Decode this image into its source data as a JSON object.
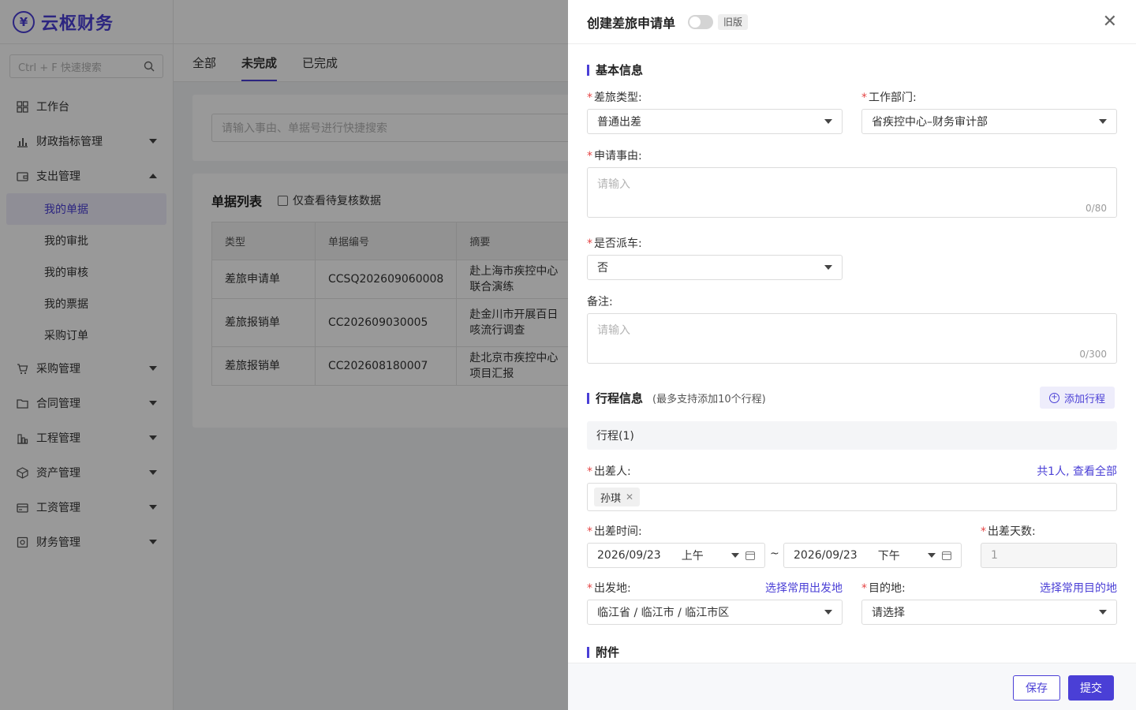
{
  "app": {
    "logo_glyph": "¥",
    "title": "云枢财务",
    "brand_color": "#4a3fd6"
  },
  "sidebar": {
    "search_placeholder": "Ctrl + F 快速搜索",
    "menu": {
      "workbench": "工作台",
      "finance_index": "财政指标管理",
      "expense": "支出管理",
      "expense_sub": [
        "我的单据",
        "我的审批",
        "我的审核",
        "我的票据",
        "采购订单"
      ],
      "purchase": "采购管理",
      "contract": "合同管理",
      "engineering": "工程管理",
      "asset": "资产管理",
      "salary": "工资管理",
      "finance_affairs": "财务管理"
    }
  },
  "main": {
    "tabs": [
      "全部",
      "未完成",
      "已完成"
    ],
    "active_tab": "未完成",
    "quick_search_placeholder": "请输入事由、单据号进行快捷搜索",
    "list_title": "单据列表",
    "only_pending_label": "仅查看待复核数据",
    "table": {
      "headers": [
        "类型",
        "单据编号",
        "摘要"
      ],
      "rows": [
        [
          "差旅申请单",
          "CCSQ202609060008",
          "赴上海市疾控中心联合演练"
        ],
        [
          "差旅报销单",
          "CC202609030005",
          "赴金川市开展百日咳流行调查"
        ],
        [
          "差旅报销单",
          "CC202608180007",
          "赴北京市疾控中心项目汇报"
        ]
      ]
    }
  },
  "drawer": {
    "title": "创建差旅申请单",
    "version_tag": "旧版",
    "close_glyph": "✕",
    "basic_section": "基本信息",
    "trip_type_label": "差旅类型:",
    "trip_type_value": "普通出差",
    "dept_label": "工作部门:",
    "dept_value": "省疾控中心–财务审计部",
    "reason_label": "申请事由:",
    "reason_placeholder": "请输入",
    "reason_counter": "0/80",
    "car_label": "是否派车:",
    "car_value": "否",
    "remark_label": "备注:",
    "remark_placeholder": "请输入",
    "remark_counter": "0/300",
    "trip_section": "行程信息",
    "trip_hint": "(最多支持添加10个行程)",
    "add_trip": "添加行程",
    "trip_name": "行程(1)",
    "traveler_label": "出差人:",
    "traveler_link": "共1人, 查看全部",
    "traveler_chip": "孙琪",
    "time_label": "出差时间:",
    "start_date": "2026/09/23",
    "start_period": "上午",
    "range_sep": "~",
    "end_date": "2026/09/23",
    "end_period": "下午",
    "days_label": "出差天数:",
    "days_value": "1",
    "origin_label": "出发地:",
    "origin_link": "选择常用出发地",
    "origin_value": "临江省 / 临江市 / 临江市区",
    "dest_label": "目的地:",
    "dest_link": "选择常用目的地",
    "dest_value": "请选择",
    "attach_section": "附件",
    "save": "保存",
    "submit": "提交"
  }
}
